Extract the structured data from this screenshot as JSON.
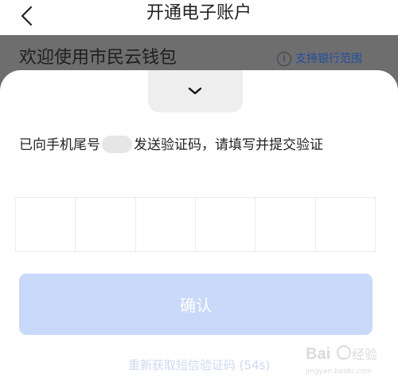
{
  "nav": {
    "title": "开通电子账户"
  },
  "background": {
    "welcome": "欢迎使用市民云钱包",
    "support_link": "支持银行范围"
  },
  "sheet": {
    "hint_prefix": "已向手机尾号",
    "hint_suffix": "发送验证码，请填写并提交验证",
    "code_cells": 6,
    "confirm_label": "确认",
    "resend_label": "重新获取短信验证码 (54s)"
  },
  "watermark": {
    "brand": "Bai经验",
    "sub": "jingyan.baidu.com"
  },
  "colors": {
    "confirm_bg": "#c9d9fa",
    "link": "#1f4fa0",
    "overlay": "#6e6e6e"
  }
}
